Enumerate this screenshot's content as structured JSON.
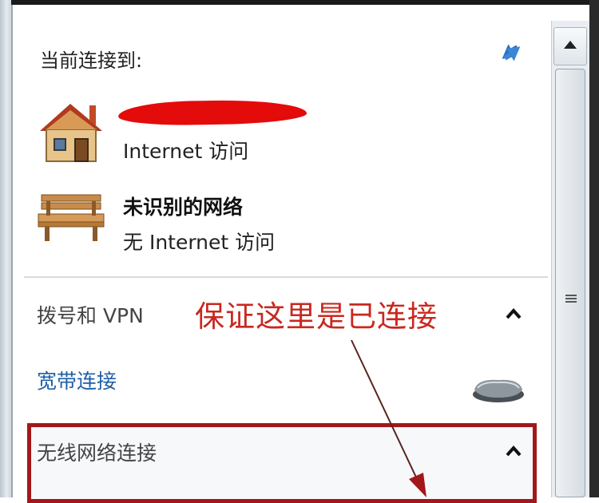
{
  "panel": {
    "current_connection_title": "当前连接到:",
    "connections": [
      {
        "status": "Internet 访问",
        "icon": "house-icon",
        "name_redacted": true
      },
      {
        "name": "未识别的网络",
        "status": "无 Internet 访问",
        "icon": "bench-icon"
      }
    ],
    "dialup_section": {
      "title": "拨号和 VPN",
      "items": [
        {
          "label": "宽带连接",
          "icon": "modem-icon"
        }
      ]
    },
    "wireless_section": {
      "title": "无线网络连接"
    }
  },
  "annotation": {
    "text": "保证这里是已连接",
    "color": "#c8281f"
  },
  "colors": {
    "link": "#1f5fa6",
    "highlight_border": "#a3161a",
    "redaction": "#e40b0b"
  }
}
